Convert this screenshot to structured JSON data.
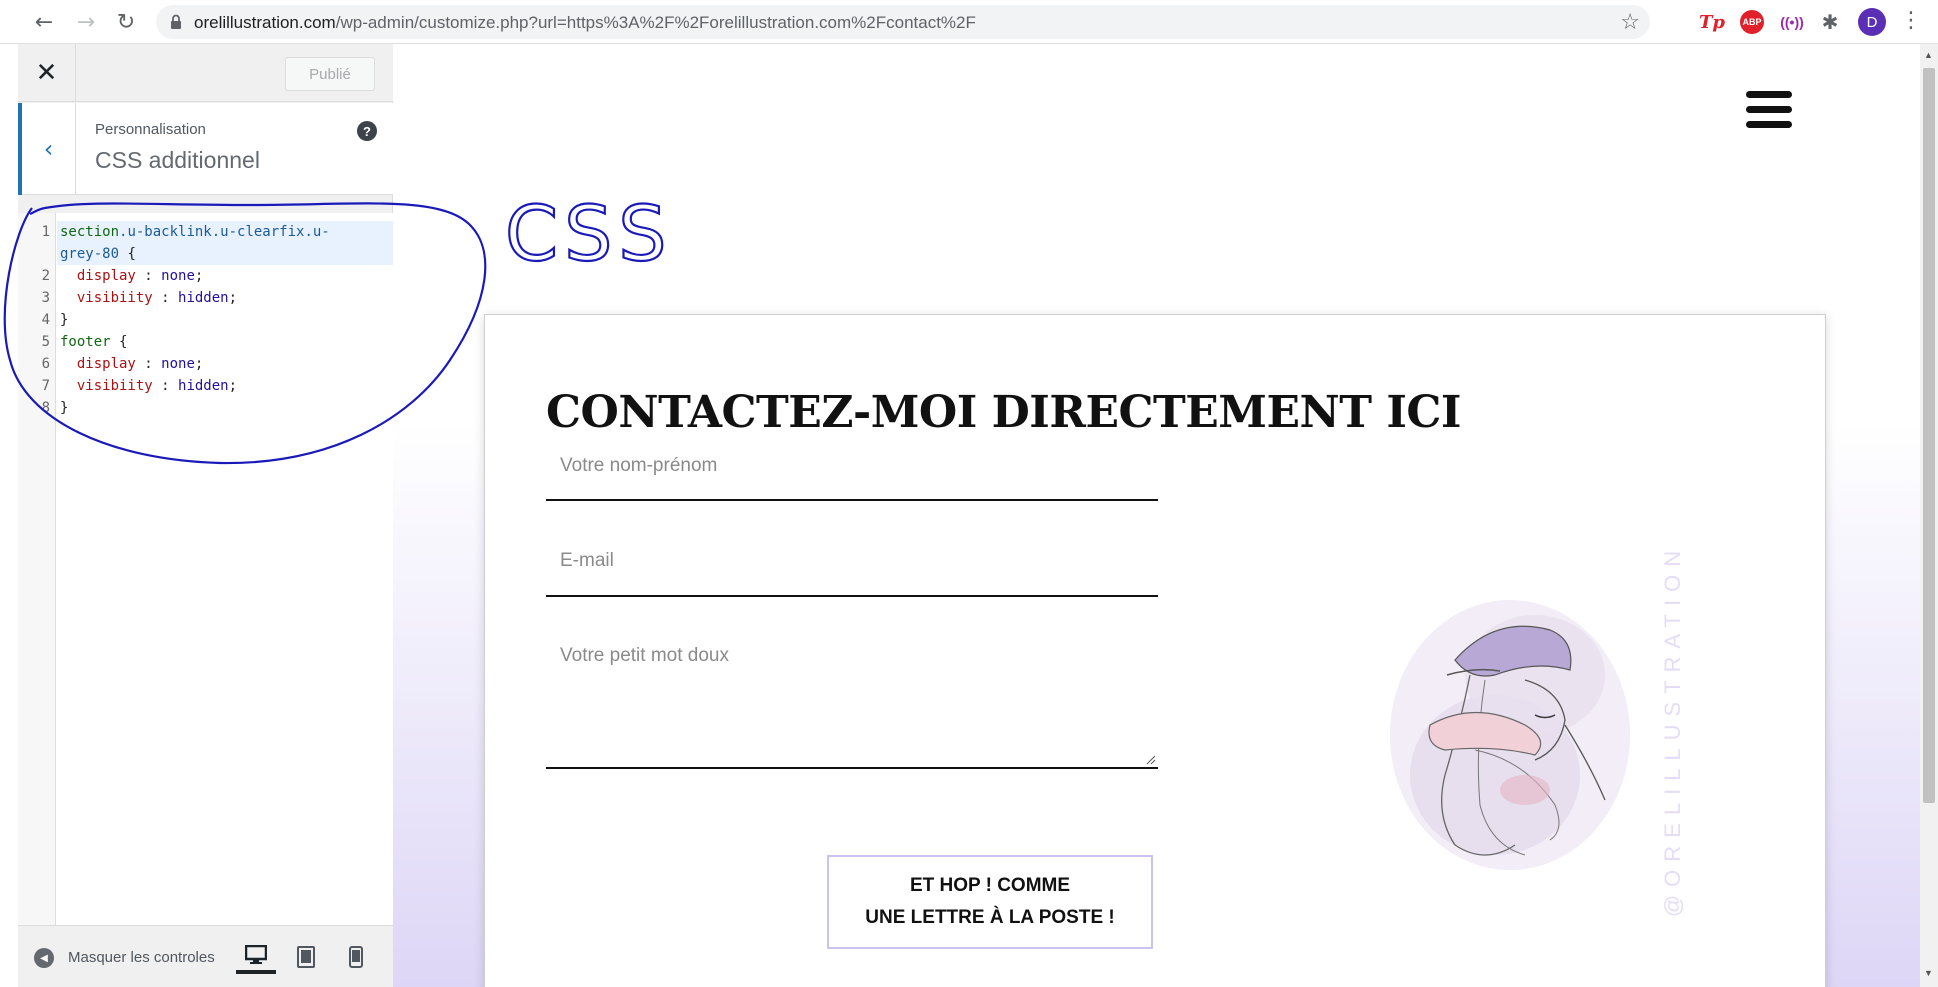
{
  "browser": {
    "url_host": "orelillustration.com",
    "url_path": "/wp-admin/customize.php?url=https%3A%2F%2Forelillustration.com%2Fcontact%2F",
    "back_icon": "←",
    "forward_icon": "→",
    "reload_icon": "↻",
    "star_icon": "☆",
    "ext_tp": "Tp",
    "ext_abp": "ABP",
    "ext_radio": "((•))",
    "ext_puzzle": "✱",
    "avatar_letter": "D",
    "menu_icon": "⋮"
  },
  "customizer": {
    "close_icon": "✕",
    "publish_label": "Publié",
    "back_icon": "‹",
    "crumb": "Personnalisation",
    "title": "CSS additionnel",
    "help_icon": "?",
    "code_lines": [
      {
        "n": "1",
        "parts": [
          [
            "sel",
            "section"
          ],
          [
            "cls",
            ".u-backlink.u-clearfix.u-"
          ]
        ]
      },
      {
        "n": "",
        "parts": [
          [
            "cls",
            "grey-80"
          ],
          [
            "",
            " {"
          ]
        ]
      },
      {
        "n": "2",
        "parts": [
          [
            "",
            "  "
          ],
          [
            "prop",
            "display"
          ],
          [
            "",
            " : "
          ],
          [
            "val",
            "none"
          ],
          [
            "",
            ";"
          ]
        ]
      },
      {
        "n": "3",
        "parts": [
          [
            "",
            "  "
          ],
          [
            "prop",
            "visibiity"
          ],
          [
            "",
            " : "
          ],
          [
            "val",
            "hidden"
          ],
          [
            "",
            ";"
          ]
        ]
      },
      {
        "n": "4",
        "parts": [
          [
            "",
            "}"
          ]
        ]
      },
      {
        "n": "5",
        "parts": [
          [
            "sel",
            "footer"
          ],
          [
            "",
            " {"
          ]
        ]
      },
      {
        "n": "6",
        "parts": [
          [
            "",
            "  "
          ],
          [
            "prop",
            "display"
          ],
          [
            "",
            " : "
          ],
          [
            "val",
            "none"
          ],
          [
            "",
            ";"
          ]
        ]
      },
      {
        "n": "7",
        "parts": [
          [
            "",
            "  "
          ],
          [
            "prop",
            "visibiity"
          ],
          [
            "",
            " : "
          ],
          [
            "val",
            "hidden"
          ],
          [
            "",
            ";"
          ]
        ]
      },
      {
        "n": "8",
        "parts": [
          [
            "",
            "}"
          ]
        ]
      }
    ],
    "collapse_label": "Masquer les controles",
    "collapse_icon": "◀"
  },
  "annotation": {
    "text": "CSS",
    "color": "#1a1ab8"
  },
  "preview": {
    "title": "CONTACTEZ-MOI DIRECTEMENT ICI",
    "name_placeholder": "Votre nom-prénom",
    "email_placeholder": "E-mail",
    "message_placeholder": "Votre petit mot doux",
    "submit_line1": "ET HOP ! COMME",
    "submit_line2": "UNE LETTRE À LA POSTE !",
    "vertical_brand": "@ORELILLUSTRATION",
    "accent_color": "#ddd6f6"
  }
}
